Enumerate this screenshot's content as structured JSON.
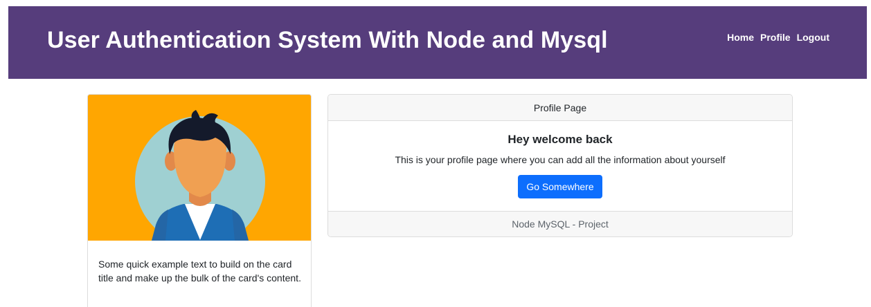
{
  "navbar": {
    "brand": "User Authentication System With Node and Mysql",
    "links": [
      "Home",
      "Profile",
      "Logout"
    ]
  },
  "profile_card": {
    "image_icon": "avatar-illustration",
    "text": "Some quick example text to build on the card title and make up the bulk of the card's content."
  },
  "main_card": {
    "header": "Profile Page",
    "title": "Hey welcome back",
    "text": "This is your profile page where you can add all the information about yourself",
    "button_label": "Go Somewhere",
    "footer": "Node MySQL - Project"
  },
  "colors": {
    "navbar_bg": "#563d7c",
    "button_bg": "#0d6efd",
    "image_bg": "#ffa601",
    "avatar_circle": "#9fd0d2",
    "skin": "#f0a052",
    "hair": "#141a2b",
    "jacket": "#1e6eb5"
  }
}
